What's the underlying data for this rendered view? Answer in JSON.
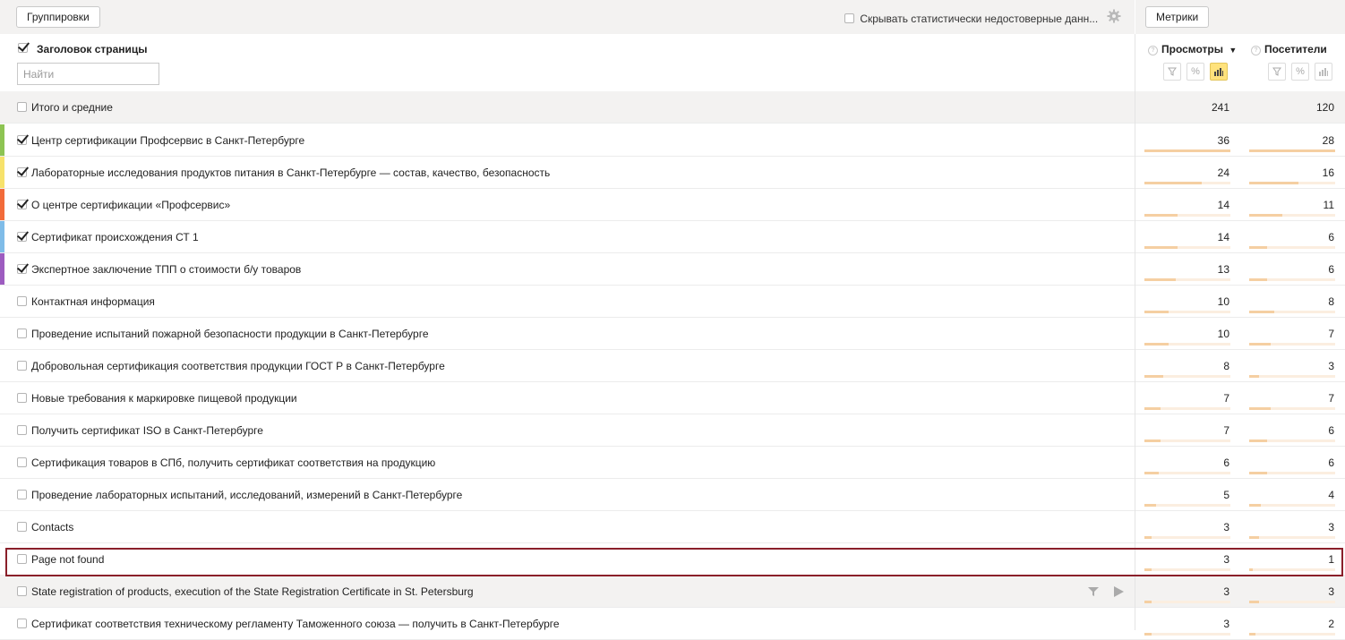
{
  "toolbar": {
    "groupings_label": "Группировки",
    "hide_unreliable_label": "Скрывать статистически недостоверные данн...",
    "metrics_label": "Метрики"
  },
  "header": {
    "dimension_title": "Заголовок страницы",
    "search_placeholder": "Найти",
    "col_views": "Просмотры",
    "col_views_sort": "▼",
    "col_visitors": "Посетители",
    "help_glyph": "?"
  },
  "totals": {
    "label": "Итого и средние",
    "views": "241",
    "visitors": "120"
  },
  "colors": {
    "stripe_1": "#8dc453",
    "stripe_2": "#f7e26b",
    "stripe_3": "#f26b3a",
    "stripe_4": "#7fbce8",
    "stripe_5": "#9d5cc0",
    "highlight": "#8a1f2a",
    "bar": "#f5cfa2"
  },
  "rows": [
    {
      "title": "Центр сертификации Профсервис в Санкт-Петербурге",
      "checked": true,
      "views": "36",
      "visitors": "28"
    },
    {
      "title": "Лабораторные исследования продуктов питания в Санкт-Петербурге — состав, качество, безопасность",
      "checked": true,
      "views": "24",
      "visitors": "16"
    },
    {
      "title": "О центре сертификации «Профсервис»",
      "checked": true,
      "views": "14",
      "visitors": "11"
    },
    {
      "title": "Сертификат происхождения СТ 1",
      "checked": true,
      "views": "14",
      "visitors": "6"
    },
    {
      "title": "Экспертное заключение ТПП о стоимости б/у товаров",
      "checked": true,
      "views": "13",
      "visitors": "6"
    },
    {
      "title": "Контактная информация",
      "checked": false,
      "views": "10",
      "visitors": "8"
    },
    {
      "title": "Проведение испытаний пожарной безопасности продукции в Санкт-Петербурге",
      "checked": false,
      "views": "10",
      "visitors": "7"
    },
    {
      "title": "Добровольная сертификация соответствия продукции ГОСТ Р в Санкт-Петербурге",
      "checked": false,
      "views": "8",
      "visitors": "3"
    },
    {
      "title": "Новые требования к маркировке пищевой продукции",
      "checked": false,
      "views": "7",
      "visitors": "7"
    },
    {
      "title": "Получить сертификат ISO в Санкт-Петербурге",
      "checked": false,
      "views": "7",
      "visitors": "6"
    },
    {
      "title": "Сертификация товаров в СПб, получить сертификат соответствия на продукцию",
      "checked": false,
      "views": "6",
      "visitors": "6"
    },
    {
      "title": "Проведение лабораторных испытаний, исследований, измерений в Санкт-Петербурге",
      "checked": false,
      "views": "5",
      "visitors": "4"
    },
    {
      "title": "Contacts",
      "checked": false,
      "views": "3",
      "visitors": "3"
    },
    {
      "title": "Page not found",
      "checked": false,
      "views": "3",
      "visitors": "1"
    },
    {
      "title": "State registration of products, execution of the State Registration Certificate in St. Petersburg",
      "checked": false,
      "views": "3",
      "visitors": "3"
    },
    {
      "title": "Сертификат соответствия техническому регламенту Таможенного союза — получить в Санкт-Петербурге",
      "checked": false,
      "views": "3",
      "visitors": "2"
    }
  ],
  "bars": {
    "views": [
      1.0,
      0.67,
      0.39,
      0.39,
      0.36,
      0.28,
      0.28,
      0.22,
      0.19,
      0.19,
      0.17,
      0.14,
      0.08,
      0.08,
      0.08,
      0.08
    ],
    "visitors": [
      1.0,
      0.57,
      0.39,
      0.21,
      0.21,
      0.29,
      0.25,
      0.11,
      0.25,
      0.21,
      0.21,
      0.14,
      0.11,
      0.04,
      0.11,
      0.07
    ]
  }
}
